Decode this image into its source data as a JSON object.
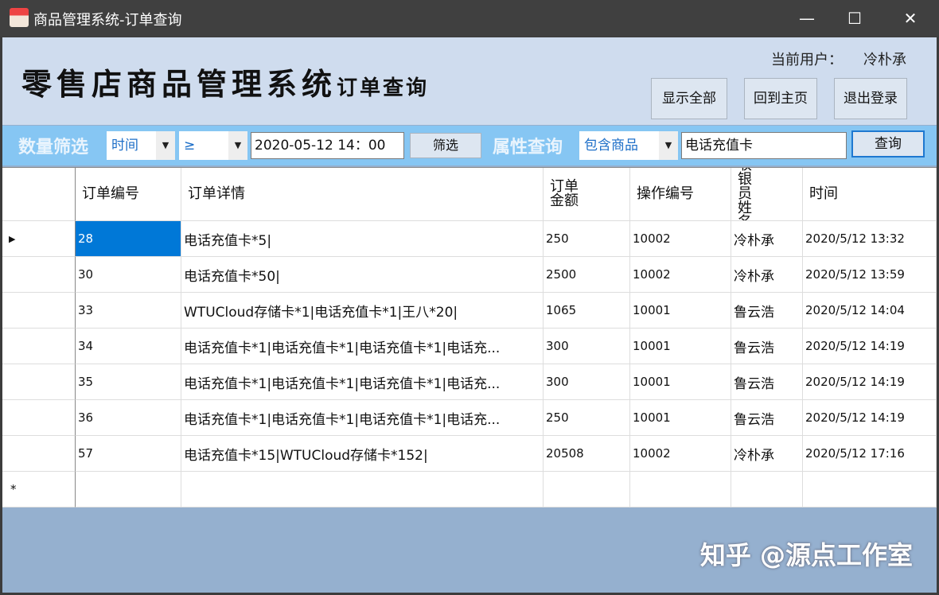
{
  "window": {
    "title": "商品管理系统-订单查询",
    "minimize": "—",
    "maximize": "☐",
    "close": "✕"
  },
  "header": {
    "logo_main": "零售店商品管理系统",
    "logo_sub": "订单查询",
    "user_label": "当前用户：",
    "user_name": "冷朴承",
    "buttons": {
      "show_all": "显示全部",
      "home": "回到主页",
      "logout": "退出登录"
    }
  },
  "filter": {
    "qty_label": "数量筛选",
    "field": "时间",
    "operator": "≥",
    "value": "2020-05-12 14：00",
    "filter_btn": "筛选",
    "attr_label": "属性查询",
    "attr_field": "包含商品",
    "attr_value": "电话充值卡",
    "query_btn": "查询"
  },
  "grid": {
    "columns": [
      "订单编号",
      "订单详情",
      "订单金额",
      "操作编号",
      "收银员姓名",
      "时间"
    ],
    "rows": [
      [
        "28",
        "电话充值卡*5|",
        "250",
        "10002",
        "冷朴承",
        "2020/5/12 13:32"
      ],
      [
        "30",
        "电话充值卡*50|",
        "2500",
        "10002",
        "冷朴承",
        "2020/5/12 13:59"
      ],
      [
        "33",
        "WTUCloud存储卡*1|电话充值卡*1|王八*20|",
        "1065",
        "10001",
        "鲁云浩",
        "2020/5/12 14:04"
      ],
      [
        "34",
        "电话充值卡*1|电话充值卡*1|电话充值卡*1|电话充...",
        "300",
        "10001",
        "鲁云浩",
        "2020/5/12 14:19"
      ],
      [
        "35",
        "电话充值卡*1|电话充值卡*1|电话充值卡*1|电话充...",
        "300",
        "10001",
        "鲁云浩",
        "2020/5/12 14:19"
      ],
      [
        "36",
        "电话充值卡*1|电话充值卡*1|电话充值卡*1|电话充...",
        "250",
        "10001",
        "鲁云浩",
        "2020/5/12 14:19"
      ],
      [
        "57",
        "电话充值卡*15|WTUCloud存储卡*152|",
        "20508",
        "10002",
        "冷朴承",
        "2020/5/12 17:16"
      ]
    ],
    "current_marker": "▶",
    "new_marker": "*"
  },
  "watermark": "知乎 @源点工作室"
}
